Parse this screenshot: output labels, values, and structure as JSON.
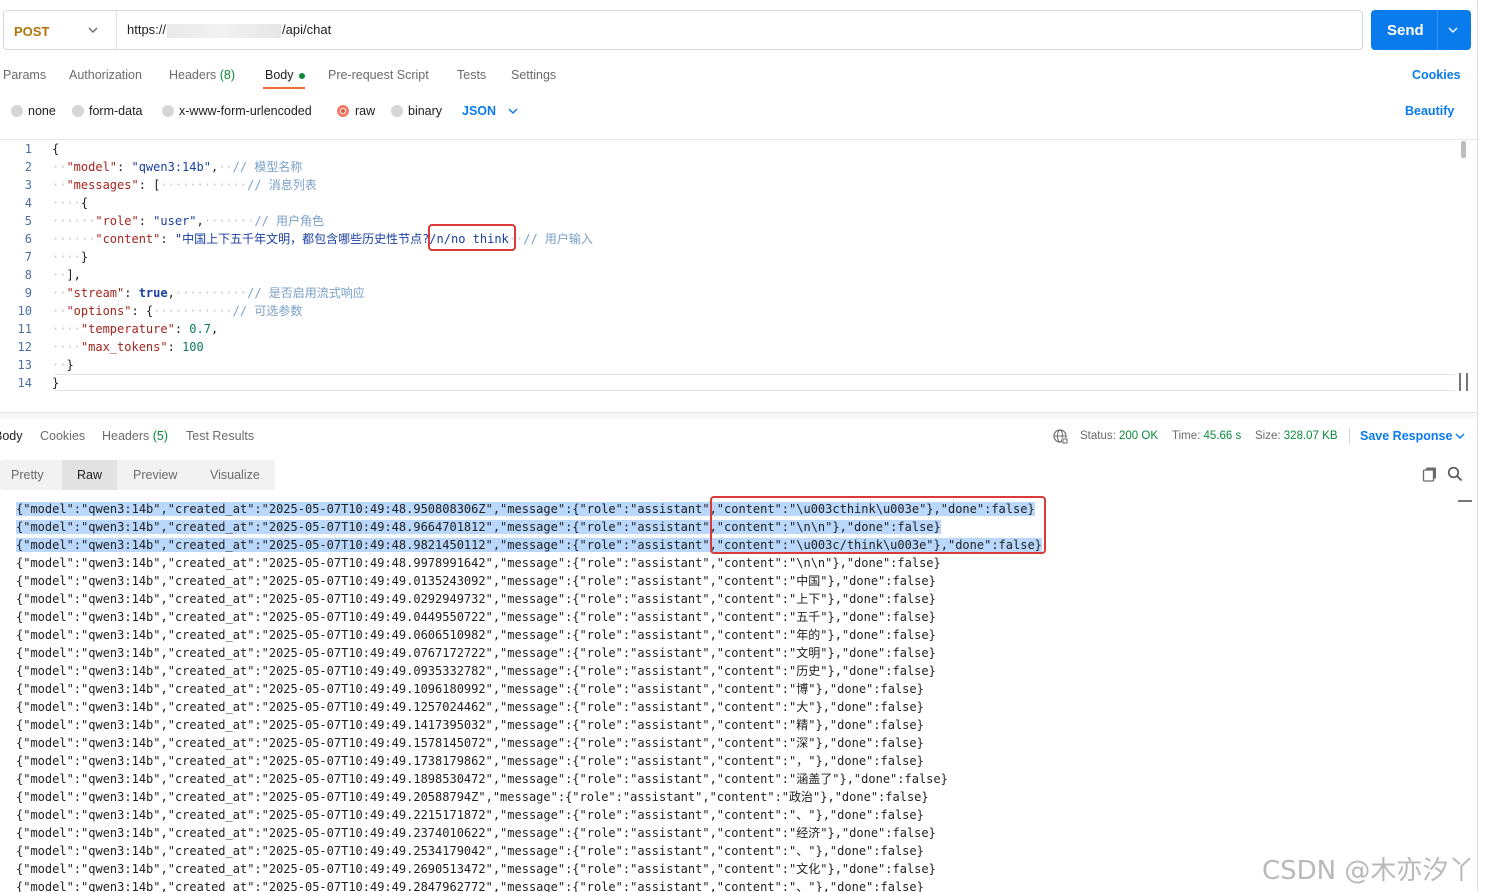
{
  "request": {
    "method": "POST",
    "url_prefix": "https://",
    "url_suffix": "/api/chat",
    "send_label": "Send"
  },
  "request_tabs": {
    "params": "Params",
    "authorization": "Authorization",
    "headers": "Headers",
    "headers_count": "(8)",
    "body": "Body",
    "pre_request": "Pre-request Script",
    "tests": "Tests",
    "settings": "Settings",
    "cookies": "Cookies"
  },
  "body_types": {
    "none": "none",
    "form_data": "form-data",
    "urlencoded": "x-www-form-urlencoded",
    "raw": "raw",
    "binary": "binary",
    "format": "JSON",
    "beautify": "Beautify",
    "selected": "raw"
  },
  "editor": {
    "line_numbers": [
      "1",
      "2",
      "3",
      "4",
      "5",
      "6",
      "7",
      "8",
      "9",
      "10",
      "11",
      "12",
      "13",
      "14"
    ],
    "l1": "{",
    "l2_key": "\"model\"",
    "l2_val": "\"qwen3:14b\"",
    "l2_comment": "// 模型名称",
    "l3_key": "\"messages\"",
    "l3_comment": "// 消息列表",
    "l4": "{",
    "l5_key": "\"role\"",
    "l5_val": "\"user\"",
    "l5_comment": "// 用户角色",
    "l6_key": "\"content\"",
    "l6_val": "\"中国上下五千年文明，都包含哪些历史性节点?",
    "l6_think": "/n/no think",
    "l6_comment": "// 用户输入",
    "l7": "}",
    "l8": "],",
    "l9_key": "\"stream\"",
    "l9_val": "true",
    "l9_comment": "// 是否启用流式响应",
    "l10_key": "\"options\"",
    "l10_comment": "// 可选参数",
    "l11_key": "\"temperature\"",
    "l11_val": "0.7",
    "l12_key": "\"max_tokens\"",
    "l12_val": "100",
    "l13": "}",
    "l14": "}"
  },
  "response_tabs": {
    "body": "Body",
    "cookies": "Cookies",
    "headers": "Headers",
    "headers_count": "(5)",
    "test_results": "Test Results"
  },
  "response_meta": {
    "status_label": "Status:",
    "status_value": "200 OK",
    "time_label": "Time:",
    "time_value": "45.66 s",
    "size_label": "Size:",
    "size_value": "328.07 KB",
    "save_response": "Save Response"
  },
  "format_tabs": {
    "pretty": "Pretty",
    "raw": "Raw",
    "preview": "Preview",
    "visualize": "Visualize",
    "selected": "Raw"
  },
  "response_lines": [
    "{\"model\":\"qwen3:14b\",\"created_at\":\"2025-05-07T10:49:48.950808306Z\",\"message\":{\"role\":\"assistant\",\"content\":\"\\u003cthink\\u003e\"},\"done\":false}",
    "{\"model\":\"qwen3:14b\",\"created_at\":\"2025-05-07T10:49:48.9664701812\",\"message\":{\"role\":\"assistant\",\"content\":\"\\n\\n\"},\"done\":false}",
    "{\"model\":\"qwen3:14b\",\"created_at\":\"2025-05-07T10:49:48.9821450112\",\"message\":{\"role\":\"assistant\",\"content\":\"\\u003c/think\\u003e\"},\"done\":false}",
    "{\"model\":\"qwen3:14b\",\"created_at\":\"2025-05-07T10:49:48.9978991642\",\"message\":{\"role\":\"assistant\",\"content\":\"\\n\\n\"},\"done\":false}",
    "{\"model\":\"qwen3:14b\",\"created_at\":\"2025-05-07T10:49:49.0135243092\",\"message\":{\"role\":\"assistant\",\"content\":\"中国\"},\"done\":false}",
    "{\"model\":\"qwen3:14b\",\"created_at\":\"2025-05-07T10:49:49.0292949732\",\"message\":{\"role\":\"assistant\",\"content\":\"上下\"},\"done\":false}",
    "{\"model\":\"qwen3:14b\",\"created_at\":\"2025-05-07T10:49:49.0449550722\",\"message\":{\"role\":\"assistant\",\"content\":\"五千\"},\"done\":false}",
    "{\"model\":\"qwen3:14b\",\"created_at\":\"2025-05-07T10:49:49.0606510982\",\"message\":{\"role\":\"assistant\",\"content\":\"年的\"},\"done\":false}",
    "{\"model\":\"qwen3:14b\",\"created_at\":\"2025-05-07T10:49:49.0767172722\",\"message\":{\"role\":\"assistant\",\"content\":\"文明\"},\"done\":false}",
    "{\"model\":\"qwen3:14b\",\"created_at\":\"2025-05-07T10:49:49.0935332782\",\"message\":{\"role\":\"assistant\",\"content\":\"历史\"},\"done\":false}",
    "{\"model\":\"qwen3:14b\",\"created_at\":\"2025-05-07T10:49:49.1096180992\",\"message\":{\"role\":\"assistant\",\"content\":\"博\"},\"done\":false}",
    "{\"model\":\"qwen3:14b\",\"created_at\":\"2025-05-07T10:49:49.1257024462\",\"message\":{\"role\":\"assistant\",\"content\":\"大\"},\"done\":false}",
    "{\"model\":\"qwen3:14b\",\"created_at\":\"2025-05-07T10:49:49.1417395032\",\"message\":{\"role\":\"assistant\",\"content\":\"精\"},\"done\":false}",
    "{\"model\":\"qwen3:14b\",\"created_at\":\"2025-05-07T10:49:49.1578145072\",\"message\":{\"role\":\"assistant\",\"content\":\"深\"},\"done\":false}",
    "{\"model\":\"qwen3:14b\",\"created_at\":\"2025-05-07T10:49:49.1738179862\",\"message\":{\"role\":\"assistant\",\"content\":\"，\"},\"done\":false}",
    "{\"model\":\"qwen3:14b\",\"created_at\":\"2025-05-07T10:49:49.1898530472\",\"message\":{\"role\":\"assistant\",\"content\":\"涵盖了\"},\"done\":false}",
    "{\"model\":\"qwen3:14b\",\"created_at\":\"2025-05-07T10:49:49.20588794Z\",\"message\":{\"role\":\"assistant\",\"content\":\"政治\"},\"done\":false}",
    "{\"model\":\"qwen3:14b\",\"created_at\":\"2025-05-07T10:49:49.2215171872\",\"message\":{\"role\":\"assistant\",\"content\":\"、\"},\"done\":false}",
    "{\"model\":\"qwen3:14b\",\"created_at\":\"2025-05-07T10:49:49.2374010622\",\"message\":{\"role\":\"assistant\",\"content\":\"经济\"},\"done\":false}",
    "{\"model\":\"qwen3:14b\",\"created_at\":\"2025-05-07T10:49:49.2534179042\",\"message\":{\"role\":\"assistant\",\"content\":\"、\"},\"done\":false}",
    "{\"model\":\"qwen3:14b\",\"created_at\":\"2025-05-07T10:49:49.2690513472\",\"message\":{\"role\":\"assistant\",\"content\":\"文化\"},\"done\":false}",
    "{\"model\":\"qwen3:14b\",\"created_at\":\"2025-05-07T10:49:49.2847962772\",\"message\":{\"role\":\"assistant\",\"content\":\"、\"},\"done\":false}"
  ],
  "watermark": "CSDN @木亦汐丫",
  "colors": {
    "accent": "#097bed",
    "post_method": "#b0740a",
    "ok_green": "#0b8a3a",
    "highlight_box": "#d93a3a"
  }
}
